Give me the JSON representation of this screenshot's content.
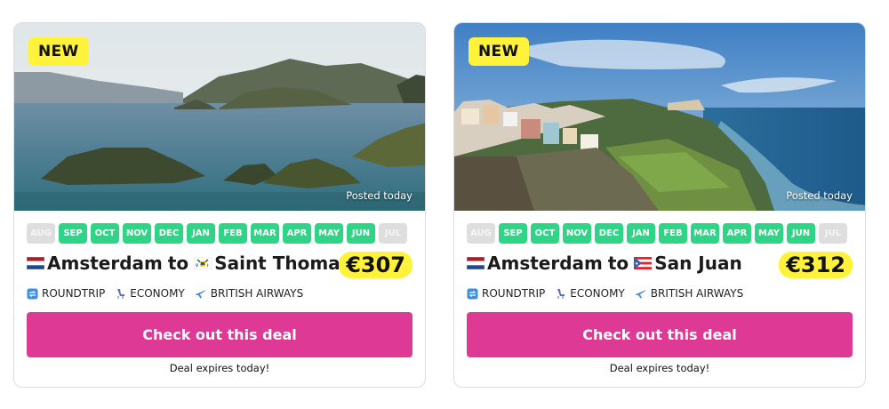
{
  "cards": [
    {
      "badge": "NEW",
      "posted": "Posted today",
      "months": [
        {
          "label": "AUG",
          "active": false
        },
        {
          "label": "SEP",
          "active": true
        },
        {
          "label": "OCT",
          "active": true
        },
        {
          "label": "NOV",
          "active": true
        },
        {
          "label": "DEC",
          "active": true
        },
        {
          "label": "JAN",
          "active": true
        },
        {
          "label": "FEB",
          "active": true
        },
        {
          "label": "MAR",
          "active": true
        },
        {
          "label": "APR",
          "active": true
        },
        {
          "label": "MAY",
          "active": true
        },
        {
          "label": "JUN",
          "active": true
        },
        {
          "label": "JUL",
          "active": false
        }
      ],
      "origin": "Amsterdam",
      "to_word": "to",
      "destination": "Saint Thomas",
      "origin_flag": "netherlands-flag-icon",
      "destination_flag": "us-virgin-islands-flag-icon",
      "price": "€307",
      "trip_type": "ROUNDTRIP",
      "cabin": "ECONOMY",
      "airline": "BRITISH AIRWAYS",
      "cta": "Check out this deal",
      "expires": "Deal expires today!"
    },
    {
      "badge": "NEW",
      "posted": "Posted today",
      "months": [
        {
          "label": "AUG",
          "active": false
        },
        {
          "label": "SEP",
          "active": true
        },
        {
          "label": "OCT",
          "active": true
        },
        {
          "label": "NOV",
          "active": true
        },
        {
          "label": "DEC",
          "active": true
        },
        {
          "label": "JAN",
          "active": true
        },
        {
          "label": "FEB",
          "active": true
        },
        {
          "label": "MAR",
          "active": true
        },
        {
          "label": "APR",
          "active": true
        },
        {
          "label": "MAY",
          "active": true
        },
        {
          "label": "JUN",
          "active": true
        },
        {
          "label": "JUL",
          "active": false
        }
      ],
      "origin": "Amsterdam",
      "to_word": "to",
      "destination": "San Juan",
      "origin_flag": "netherlands-flag-icon",
      "destination_flag": "puerto-rico-flag-icon",
      "price": "€312",
      "trip_type": "ROUNDTRIP",
      "cabin": "ECONOMY",
      "airline": "BRITISH AIRWAYS",
      "cta": "Check out this deal",
      "expires": "Deal expires today!"
    }
  ],
  "colors": {
    "badge": "#fff23a",
    "month_active": "#2fd486",
    "month_inactive": "#dedede",
    "cta": "#de3a95",
    "price_highlight": "#fff23a"
  }
}
